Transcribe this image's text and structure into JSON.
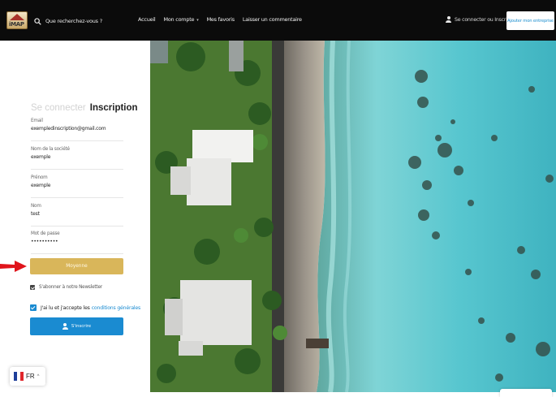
{
  "header": {
    "search_label": "Que recherchez-vous ?",
    "nav": {
      "accueil": "Accueil",
      "compte": "Mon compte",
      "favoris": "Mes favoris",
      "commentaire": "Laisser un commentaire"
    },
    "login_link": "Se connecter ou Inscription",
    "add_business": "Ajouter mon entreprise"
  },
  "form": {
    "tab_login": "Se connecter",
    "tab_signup": "Inscription",
    "email": {
      "label": "Email",
      "value": "exempledinscription@gmail.com"
    },
    "company": {
      "label": "Nom de la société",
      "value": "exemple"
    },
    "firstname": {
      "label": "Prénom",
      "value": "exemple"
    },
    "lastname": {
      "label": "Nom",
      "value": "test"
    },
    "password": {
      "label": "Mot de passe",
      "value": "••••••••••"
    },
    "gold_button": "Moyenne",
    "newsletter_label": "S'abonner à notre Newsletter",
    "newsletter_checked": true,
    "terms_prefix": "J'ai lu et j'accepte les",
    "terms_link": "conditions générales",
    "terms_checked": true,
    "signup_button": "S'inscrire"
  },
  "language": {
    "code": "FR",
    "flag_colors": [
      "#1f3f9a",
      "#ffffff",
      "#e0262b"
    ]
  },
  "colors": {
    "accent_blue": "#1a8bd1",
    "gold": "#d9b65a",
    "annotation_arrow": "#e0141b"
  },
  "hero": {
    "image": "aerial-view-of-tropical-coast-and-lagoon"
  }
}
